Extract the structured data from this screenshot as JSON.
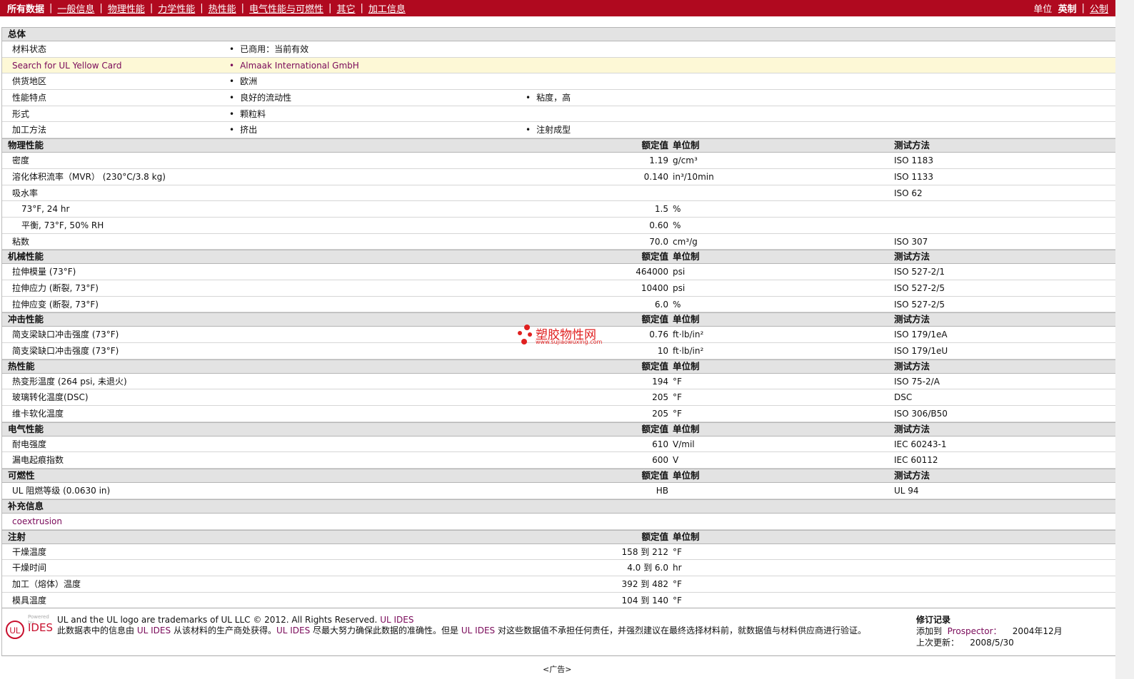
{
  "nav": {
    "items": [
      "所有数据",
      "一般信息",
      "物理性能",
      "力学性能",
      "热性能",
      "电气性能与可燃性",
      "其它",
      "加工信息"
    ],
    "units_label": "单位",
    "imperial": "英制",
    "metric": "公制"
  },
  "sections": [
    {
      "title": "总体",
      "type": "general",
      "rows": [
        {
          "label": "材料状态",
          "v1": "已商用：当前有效"
        },
        {
          "label": "Search for UL Yellow Card",
          "v1": "Almaak International GmbH",
          "highlight": true
        },
        {
          "label": "供货地区",
          "v1": "欧洲"
        },
        {
          "label": "性能特点",
          "v1": "良好的流动性",
          "v2": "粘度，高"
        },
        {
          "label": "形式",
          "v1": "颗粒料"
        },
        {
          "label": "加工方法",
          "v1": "挤出",
          "v2": "注射成型"
        }
      ]
    },
    {
      "title": "物理性能",
      "h_val": "额定值",
      "h_unit": "单位制",
      "h_test": "测试方法",
      "rows": [
        {
          "label": "密度",
          "val": "1.19",
          "unit": "g/cm³",
          "test": "ISO 1183"
        },
        {
          "label": "溶化体积流率（MVR） (230°C/3.8 kg)",
          "val": "0.140",
          "unit": "in³/10min",
          "test": "ISO 1133"
        },
        {
          "label": "吸水率",
          "test": "ISO 62"
        },
        {
          "label": "73°F, 24 hr",
          "sub": true,
          "val": "1.5",
          "unit": "%"
        },
        {
          "label": "平衡, 73°F, 50% RH",
          "sub": true,
          "val": "0.60",
          "unit": "%"
        },
        {
          "label": "粘数",
          "val": "70.0",
          "unit": "cm³/g",
          "test": "ISO 307"
        }
      ]
    },
    {
      "title": "机械性能",
      "h_val": "额定值",
      "h_unit": "单位制",
      "h_test": "测试方法",
      "rows": [
        {
          "label": "拉伸模量 (73°F)",
          "val": "464000",
          "unit": "psi",
          "test": "ISO 527-2/1"
        },
        {
          "label": "拉伸应力 (断裂, 73°F)",
          "val": "10400",
          "unit": "psi",
          "test": "ISO 527-2/5"
        },
        {
          "label": "拉伸应变 (断裂, 73°F)",
          "val": "6.0",
          "unit": "%",
          "test": "ISO 527-2/5"
        }
      ]
    },
    {
      "title": "冲击性能",
      "h_val": "额定值",
      "h_unit": "单位制",
      "h_test": "测试方法",
      "rows": [
        {
          "label": "简支梁缺口冲击强度 (73°F)",
          "val": "0.76",
          "unit": "ft·lb/in²",
          "test": "ISO 179/1eA"
        },
        {
          "label": "简支梁缺口冲击强度 (73°F)",
          "val": "10",
          "unit": "ft·lb/in²",
          "test": "ISO 179/1eU"
        }
      ]
    },
    {
      "title": "热性能",
      "h_val": "额定值",
      "h_unit": "单位制",
      "h_test": "测试方法",
      "rows": [
        {
          "label": "热变形温度 (264 psi, 未退火)",
          "val": "194",
          "unit": "°F",
          "test": "ISO 75-2/A"
        },
        {
          "label": "玻璃转化温度(DSC)",
          "val": "205",
          "unit": "°F",
          "test": "DSC"
        },
        {
          "label": "维卡软化温度",
          "val": "205",
          "unit": "°F",
          "test": "ISO 306/B50"
        }
      ]
    },
    {
      "title": "电气性能",
      "h_val": "额定值",
      "h_unit": "单位制",
      "h_test": "测试方法",
      "rows": [
        {
          "label": "耐电强度",
          "val": "610",
          "unit": "V/mil",
          "test": "IEC 60243-1"
        },
        {
          "label": "漏电起痕指数",
          "val": "600",
          "unit": "V",
          "test": "IEC 60112"
        }
      ]
    },
    {
      "title": "可燃性",
      "h_val": "额定值",
      "h_unit": "单位制",
      "h_test": "测试方法",
      "rows": [
        {
          "label": "UL 阻燃等级 (0.0630 in)",
          "val": "HB",
          "test": "UL 94"
        }
      ]
    },
    {
      "title": "补充信息",
      "rows": [
        {
          "label": "coextrusion",
          "link": true
        }
      ]
    },
    {
      "title": "注射",
      "h_val": "额定值",
      "h_unit": "单位制",
      "rows": [
        {
          "label": "干燥温度",
          "val": "158 到  212",
          "unit": "°F"
        },
        {
          "label": "干燥时间",
          "val": "4.0 到  6.0",
          "unit": "hr"
        },
        {
          "label": "加工（熔体）温度",
          "val": "392 到  482",
          "unit": "°F"
        },
        {
          "label": "模具温度",
          "val": "104 到  140",
          "unit": "°F"
        }
      ]
    }
  ],
  "watermark": {
    "name": "塑胶物性网",
    "url": "www.sujiaowuxing.com"
  },
  "footer": {
    "logo_powered": "Powered by",
    "logo_ul": "UL",
    "logo_ides": "IDES",
    "trademark": "UL and the UL logo are trademarks of UL LLC © 2012. All Rights Reserved.",
    "trademark_link": "UL IDES",
    "disc1": "此数据表中的信息由",
    "ides": "UL IDES",
    "disc2": "从该材料的生产商处获得。",
    "disc3": "尽最大努力确保此数据的准确性。但是",
    "disc4": "对这些数据值不承担任何责任，并强烈建议在最终选择材料前，就数据值与材料供应商进行验证。",
    "rev_title": "修订记录",
    "added_label": "添加到",
    "prospector": "Prospector：",
    "added_date": "2004年12月",
    "updated_label": "上次更新：",
    "updated_date": "2008/5/30"
  },
  "ad_label": "<广告>"
}
